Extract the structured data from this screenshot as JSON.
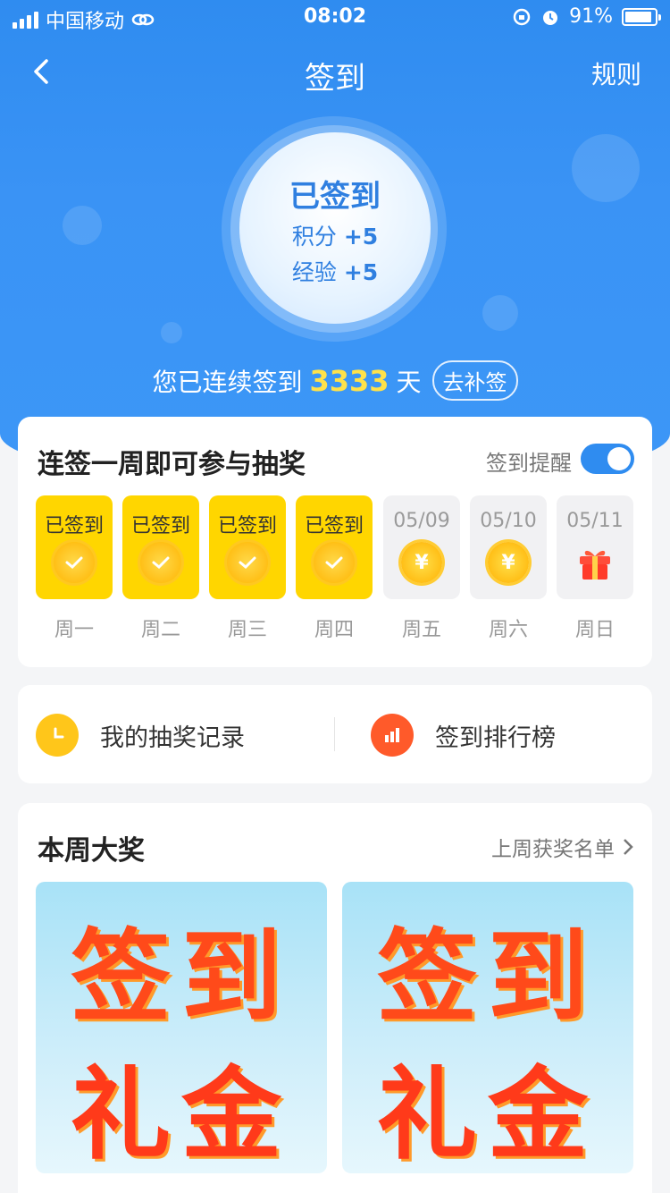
{
  "status_bar": {
    "carrier": "中国移动",
    "time": "08:02",
    "battery": "91%"
  },
  "nav": {
    "title": "签到",
    "rules": "规则"
  },
  "checkin_circle": {
    "status": "已签到",
    "points_label": "积分",
    "points_value": "+5",
    "exp_label": "经验",
    "exp_value": "+5"
  },
  "streak": {
    "prefix": "您已连续签到",
    "days": "3333",
    "suffix": "天",
    "makeup_button": "去补签"
  },
  "week_card": {
    "title": "连签一周即可参与抽奖",
    "reminder_label": "签到提醒",
    "reminder_on": true,
    "days": [
      {
        "top": "已签到",
        "label": "周一",
        "state": "done"
      },
      {
        "top": "已签到",
        "label": "周二",
        "state": "done"
      },
      {
        "top": "已签到",
        "label": "周三",
        "state": "done"
      },
      {
        "top": "已签到",
        "label": "周四",
        "state": "done"
      },
      {
        "top": "05/09",
        "label": "周五",
        "state": "coin"
      },
      {
        "top": "05/10",
        "label": "周六",
        "state": "coin"
      },
      {
        "top": "05/11",
        "label": "周日",
        "state": "gift"
      }
    ],
    "coin_symbol": "¥"
  },
  "links_card": {
    "lottery_record": "我的抽奖记录",
    "ranking": "签到排行榜"
  },
  "prize_card": {
    "title": "本周大奖",
    "last_week_link": "上周获奖名单",
    "prizes": [
      {
        "line1": "签到",
        "line2": "礼金"
      },
      {
        "line1": "签到",
        "line2": "礼金"
      }
    ]
  },
  "colors": {
    "primary_blue": "#2f8cf0",
    "done_yellow": "#ffd600",
    "streak_number": "#ffe24a",
    "prize_red": "#ff4a1a"
  }
}
